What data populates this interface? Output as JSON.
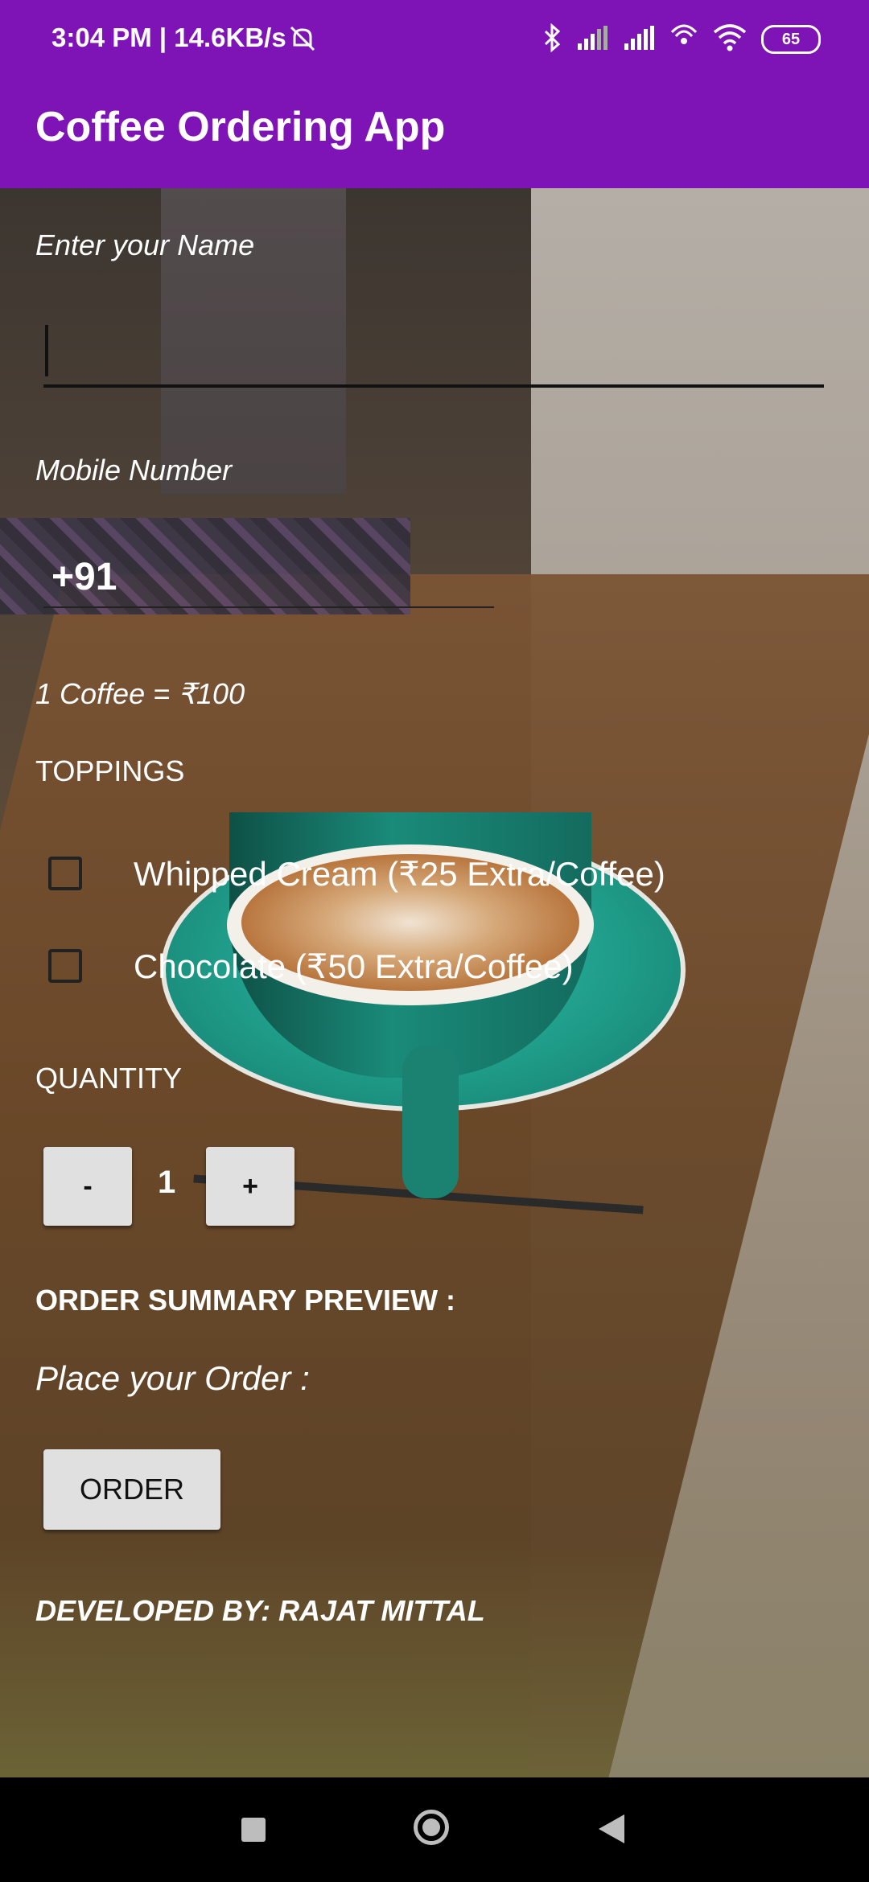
{
  "status_bar": {
    "time_speed": "3:04 PM | 14.6KB/s",
    "battery": "65",
    "icons": [
      "mute-icon",
      "bluetooth-icon",
      "signal-icon",
      "signal-icon",
      "hotspot-icon",
      "wifi-icon",
      "battery-icon"
    ]
  },
  "app_bar": {
    "title": "Coffee Ordering App",
    "color": "#7e14b5"
  },
  "form": {
    "name_label": "Enter your Name",
    "name_value": "",
    "mobile_label": "Mobile Number",
    "mobile_prefix": "+91",
    "price_text": "1 Coffee = ₹100",
    "toppings_heading": "TOPPINGS",
    "toppings": [
      {
        "label": "Whipped Cream (₹25 Extra/Coffee)",
        "checked": false
      },
      {
        "label": "Chocolate (₹50 Extra/Coffee)",
        "checked": false
      }
    ],
    "quantity_heading": "QUANTITY",
    "minus_label": "-",
    "quantity_value": "1",
    "plus_label": "+",
    "summary_heading": "ORDER SUMMARY PREVIEW :",
    "place_order_label": "Place your Order :",
    "order_button": "ORDER",
    "developer_credit": "DEVELOPED BY: RAJAT MITTAL"
  },
  "nav_bar": {
    "icons": [
      "recents-icon",
      "home-icon",
      "back-icon"
    ]
  }
}
